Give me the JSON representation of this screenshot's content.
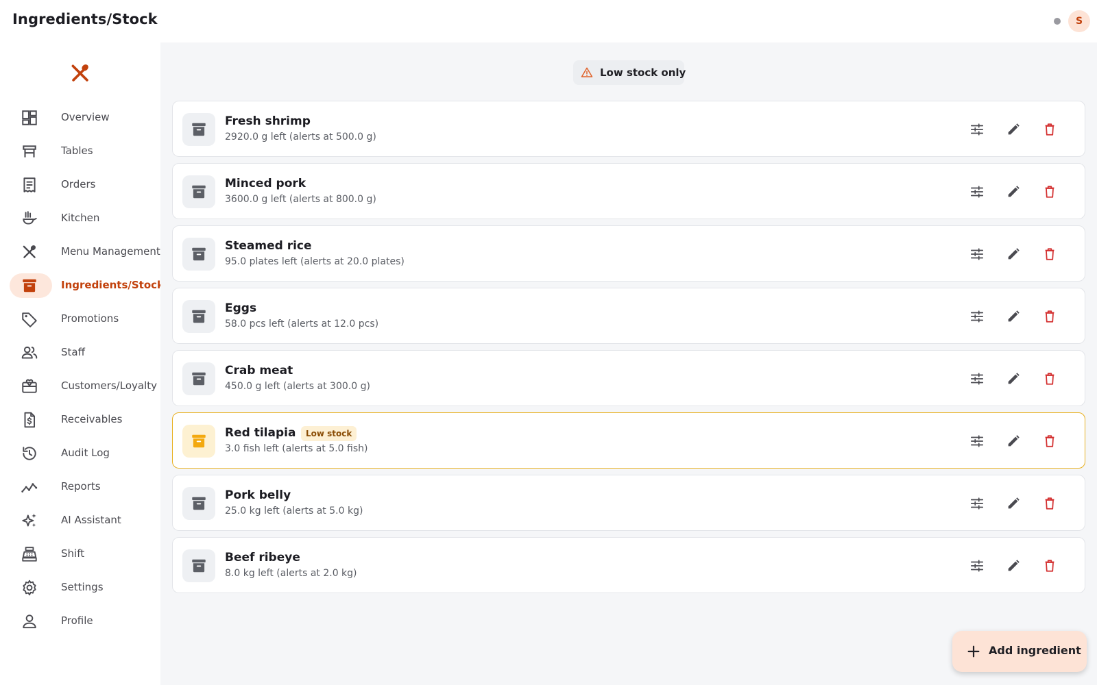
{
  "header": {
    "title": "Ingredients/Stock",
    "avatar_initial": "S"
  },
  "sidebar": {
    "logo_icon": "fork-spoon-icon",
    "items": [
      {
        "label": "Overview",
        "icon": "dashboard-icon",
        "active": false
      },
      {
        "label": "Tables",
        "icon": "table-icon",
        "active": false
      },
      {
        "label": "Orders",
        "icon": "receipt-icon",
        "active": false
      },
      {
        "label": "Kitchen",
        "icon": "kitchen-icon",
        "active": false
      },
      {
        "label": "Menu Management",
        "icon": "fork-spoon-icon",
        "active": false
      },
      {
        "label": "Ingredients/Stock",
        "icon": "archive-icon",
        "active": true
      },
      {
        "label": "Promotions",
        "icon": "tag-icon",
        "active": false
      },
      {
        "label": "Staff",
        "icon": "people-icon",
        "active": false
      },
      {
        "label": "Customers/Loyalty",
        "icon": "gift-card-icon",
        "active": false
      },
      {
        "label": "Receivables",
        "icon": "invoice-dollar-icon",
        "active": false
      },
      {
        "label": "Audit Log",
        "icon": "history-icon",
        "active": false
      },
      {
        "label": "Reports",
        "icon": "trending-icon",
        "active": false
      },
      {
        "label": "AI Assistant",
        "icon": "sparkle-icon",
        "active": false
      },
      {
        "label": "Shift",
        "icon": "cash-register-icon",
        "active": false
      },
      {
        "label": "Settings",
        "icon": "gear-icon",
        "active": false
      },
      {
        "label": "Profile",
        "icon": "person-icon",
        "active": false
      }
    ]
  },
  "filter": {
    "label": "Low stock only",
    "icon": "warning-icon"
  },
  "ingredients": [
    {
      "name": "Fresh shrimp",
      "detail": "2920.0 g left (alerts at 500.0 g)",
      "low": false
    },
    {
      "name": "Minced pork",
      "detail": "3600.0 g left (alerts at 800.0 g)",
      "low": false
    },
    {
      "name": "Steamed rice",
      "detail": "95.0 plates left (alerts at 20.0 plates)",
      "low": false
    },
    {
      "name": "Eggs",
      "detail": "58.0 pcs left (alerts at 12.0 pcs)",
      "low": false
    },
    {
      "name": "Crab meat",
      "detail": "450.0 g left (alerts at 300.0 g)",
      "low": false
    },
    {
      "name": "Red tilapia",
      "detail": "3.0 fish left (alerts at 5.0 fish)",
      "low": true,
      "badge": "Low stock"
    },
    {
      "name": "Pork belly",
      "detail": "25.0 kg left (alerts at 5.0 kg)",
      "low": false
    },
    {
      "name": "Beef ribeye",
      "detail": "8.0 kg left (alerts at 2.0 kg)",
      "low": false
    }
  ],
  "row_actions": {
    "adjust_icon": "tune-icon",
    "edit_icon": "pencil-icon",
    "delete_icon": "trash-icon"
  },
  "add_button": {
    "label": "Add ingredient",
    "icon": "plus-icon"
  },
  "colors": {
    "accent": "#c2410c",
    "low_stock": "#e8b020",
    "danger": "#d32f2f",
    "background": "#f5f6f8"
  }
}
